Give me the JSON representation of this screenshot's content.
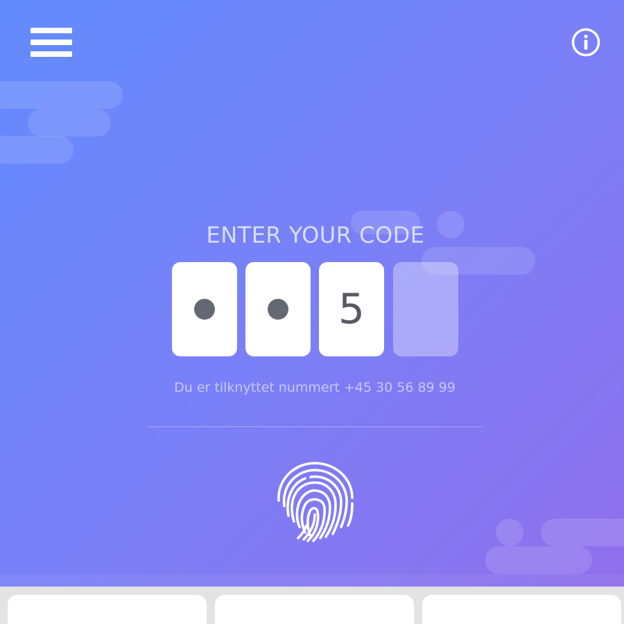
{
  "header": {
    "menu_icon": "hamburger-menu-icon",
    "info_icon": "info-icon"
  },
  "code_entry": {
    "title": "ENTER YOUR CODE",
    "digits": [
      {
        "state": "hidden",
        "value": ""
      },
      {
        "state": "hidden",
        "value": ""
      },
      {
        "state": "visible",
        "value": "5"
      },
      {
        "state": "empty",
        "value": ""
      }
    ],
    "subtitle": "Du er tilknyttet nummert +45 30 56 89 99"
  },
  "fingerprint": {
    "icon": "fingerprint-icon"
  },
  "colors": {
    "gradient_start": "#628bfd",
    "gradient_end": "#8f6fec",
    "digit_color": "#555a63",
    "panel_bg": "#e3e3e3"
  },
  "bottom_cards": [
    "card",
    "card",
    "card"
  ]
}
